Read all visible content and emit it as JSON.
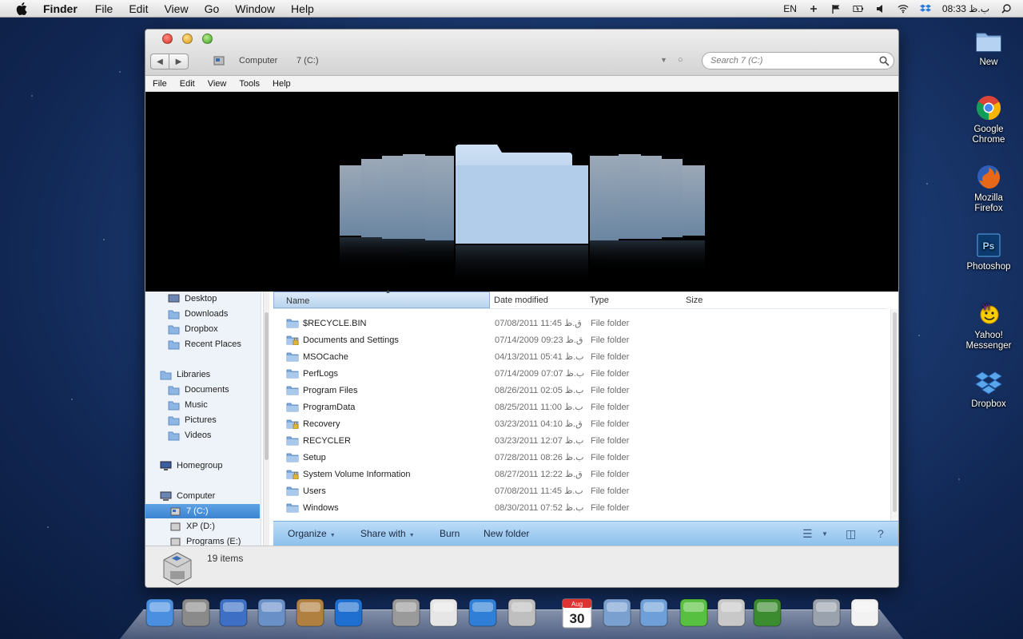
{
  "menubar": {
    "app": "Finder",
    "items": [
      "File",
      "Edit",
      "View",
      "Go",
      "Window",
      "Help"
    ],
    "lang": "EN",
    "clock": "08:33 ب.ظ"
  },
  "window": {
    "breadcrumb": [
      "Computer",
      "7 (C:)"
    ],
    "search_placeholder": "Search 7 (C:)",
    "menu": [
      "File",
      "Edit",
      "View",
      "Tools",
      "Help"
    ]
  },
  "nav": {
    "favorites": [
      "Desktop",
      "Downloads",
      "Dropbox",
      "Recent Places"
    ],
    "libraries_label": "Libraries",
    "libraries": [
      "Documents",
      "Music",
      "Pictures",
      "Videos"
    ],
    "homegroup": "Homegroup",
    "computer_label": "Computer",
    "drives": [
      "7 (C:)",
      "XP (D:)",
      "Programs (E:)"
    ],
    "selected": "7 (C:)"
  },
  "columns": [
    "Name",
    "Date modified",
    "Type",
    "Size"
  ],
  "files": [
    {
      "name": "$RECYCLE.BIN",
      "date": "07/08/2011 11:45 ق.ظ",
      "type": "File folder",
      "locked": false
    },
    {
      "name": "Documents and Settings",
      "date": "07/14/2009 09:23 ق.ظ",
      "type": "File folder",
      "locked": true
    },
    {
      "name": "MSOCache",
      "date": "04/13/2011 05:41 ب.ظ",
      "type": "File folder",
      "locked": false
    },
    {
      "name": "PerfLogs",
      "date": "07/14/2009 07:07 ب.ظ",
      "type": "File folder",
      "locked": false
    },
    {
      "name": "Program Files",
      "date": "08/26/2011 02:05 ب.ظ",
      "type": "File folder",
      "locked": false
    },
    {
      "name": "ProgramData",
      "date": "08/25/2011 11:00 ب.ظ",
      "type": "File folder",
      "locked": false
    },
    {
      "name": "Recovery",
      "date": "03/23/2011 04:10 ق.ظ",
      "type": "File folder",
      "locked": true
    },
    {
      "name": "RECYCLER",
      "date": "03/23/2011 12:07 ب.ظ",
      "type": "File folder",
      "locked": false
    },
    {
      "name": "Setup",
      "date": "07/28/2011 08:26 ب.ظ",
      "type": "File folder",
      "locked": false
    },
    {
      "name": "System Volume Information",
      "date": "08/27/2011 12:22 ق.ظ",
      "type": "File folder",
      "locked": true
    },
    {
      "name": "Users",
      "date": "07/08/2011 11:45 ب.ظ",
      "type": "File folder",
      "locked": false
    },
    {
      "name": "Windows",
      "date": "08/30/2011 07:52 ب.ظ",
      "type": "File folder",
      "locked": false
    }
  ],
  "cmdbar": {
    "organize": "Organize",
    "share": "Share with",
    "burn": "Burn",
    "new_folder": "New folder",
    "help": "?"
  },
  "details": {
    "count": "19 items"
  },
  "desktop_icons": [
    {
      "label": "New",
      "icon": "folder-icon"
    },
    {
      "label": "Google Chrome",
      "icon": "chrome-icon"
    },
    {
      "label": "Mozilla Firefox",
      "icon": "firefox-icon"
    },
    {
      "label": "Photoshop",
      "icon": "photoshop-icon"
    },
    {
      "label": "Yahoo! Messenger",
      "icon": "yahoo-messenger-icon"
    },
    {
      "label": "Dropbox",
      "icon": "dropbox-icon"
    }
  ],
  "dock": {
    "calendar_month": "Aug",
    "calendar_day": "30",
    "apps": [
      "finder-icon",
      "system-preferences-icon",
      "mission-control-icon",
      "mail-icon",
      "address-book-icon",
      "quicktime-icon",
      "preview-icon",
      "textedit-icon",
      "app-store-icon",
      "calculator-icon",
      "ical-icon",
      "weather-icon",
      "folder-stack-icon",
      "battery-icon",
      "utilities-icon",
      "activity-monitor-icon",
      "trash-icon",
      "document-icon"
    ]
  }
}
